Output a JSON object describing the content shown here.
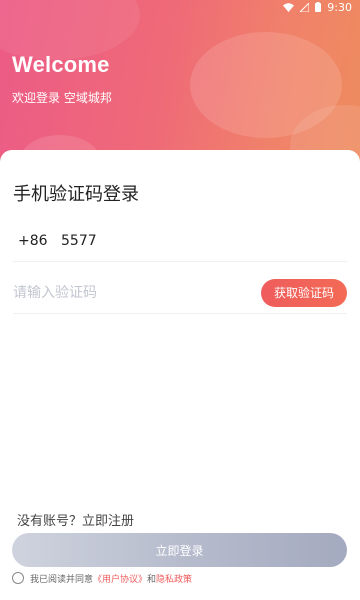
{
  "status": {
    "time": "9:30",
    "icons": [
      "wifi-icon",
      "signal-icon",
      "battery-icon"
    ]
  },
  "hero": {
    "title": "Welcome",
    "subtitle": "欢迎登录 空域城邦"
  },
  "login": {
    "title": "手机验证码登录",
    "country_code": "+86",
    "phone": "5577",
    "code_placeholder": "请输入验证码",
    "get_code_label": "获取验证码",
    "register_text": "没有账号？立即注册",
    "submit_label": "立即登录"
  },
  "agreement": {
    "prefix": "我已阅读并同意",
    "user_agreement": "《用户协议》",
    "and": "和",
    "privacy": "隐私政策",
    "checked": false
  },
  "colors": {
    "accent": "#ef5b5b",
    "gradient_start": "#ec5b86",
    "gradient_end": "#ee8c5e"
  }
}
